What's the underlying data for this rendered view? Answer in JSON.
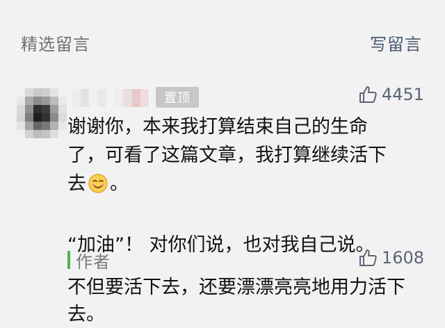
{
  "header": {
    "title": "精选留言",
    "write_label": "写留言"
  },
  "comment": {
    "pin_label": "置顶",
    "likes": "4451",
    "paragraph1": "谢谢你，本来我打算结束自己的生命了，可看了这篇文章，我打算继续活下去",
    "paragraph1_end": "。",
    "emoji": "smiling-face-icon",
    "paragraph2": "“加油”！ 对你们说，也对我自己说。"
  },
  "author_reply": {
    "label": "作者",
    "likes": "1608",
    "text": "不但要活下去，还要漂漂亮亮地用力活下去。"
  },
  "colors": {
    "background": "#f2f2f2",
    "link": "#4a5a72",
    "author_bar": "#4fb34f",
    "badge": "#c7c7c7"
  }
}
